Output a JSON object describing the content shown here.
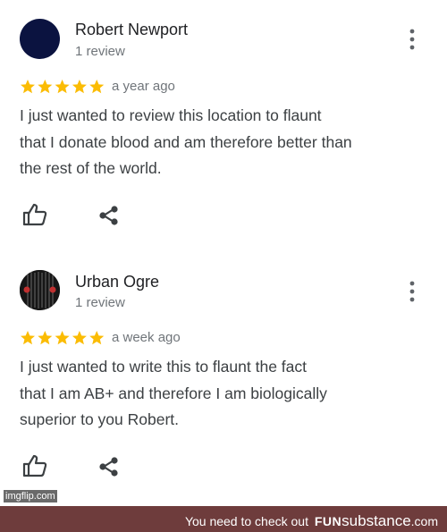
{
  "reviews": [
    {
      "author": "Robert Newport",
      "review_count": "1 review",
      "rating": 5,
      "time": "a year ago",
      "lines": [
        "I just wanted to review this location to flaunt",
        "that I donate blood and am therefore better than",
        "the rest of the world."
      ]
    },
    {
      "author": "Urban Ogre",
      "review_count": "1 review",
      "rating": 5,
      "time": "a week ago",
      "lines": [
        "I just wanted to write this to flaunt the fact",
        "that I am AB+ and therefore I am biologically",
        "superior to you Robert."
      ]
    }
  ],
  "icons": {
    "more": "more-vert-icon",
    "like": "thumbs-up-icon",
    "share": "share-icon",
    "star": "star-icon"
  },
  "colors": {
    "star": "#fbbc04",
    "secondary_text": "#70757a",
    "footer_bg": "#6e3c3c"
  },
  "footer": {
    "prefix": "You need to check out",
    "brand_a": "FUN",
    "brand_b": "substance",
    "brand_c": ".com"
  },
  "watermark": "imgflip.com"
}
